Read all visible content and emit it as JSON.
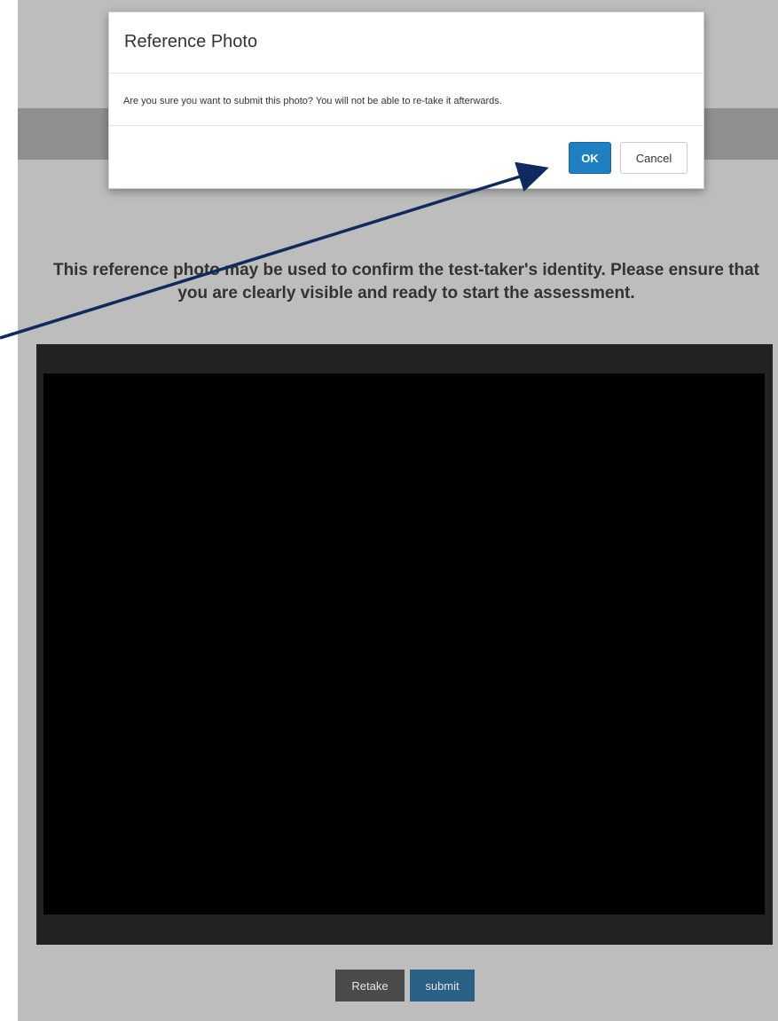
{
  "page": {
    "instructions": "This reference photo may be used to confirm the test-taker's identity. Please ensure that you are clearly visible and ready to start the assessment.",
    "retake_label": "Retake",
    "submit_label": "submit"
  },
  "modal": {
    "title": "Reference Photo",
    "message": "Are you sure you want to submit this photo? You will not be able to re-take it afterwards.",
    "ok_label": "OK",
    "cancel_label": "Cancel"
  },
  "colors": {
    "ok_button": "#1f7fc1",
    "submit_button": "#2a5f86",
    "retake_button": "#4a4a4a",
    "annotation_arrow": "#0f2a5e"
  },
  "annotation": {
    "icon": "arrow-pointer",
    "target": "ok-button"
  }
}
